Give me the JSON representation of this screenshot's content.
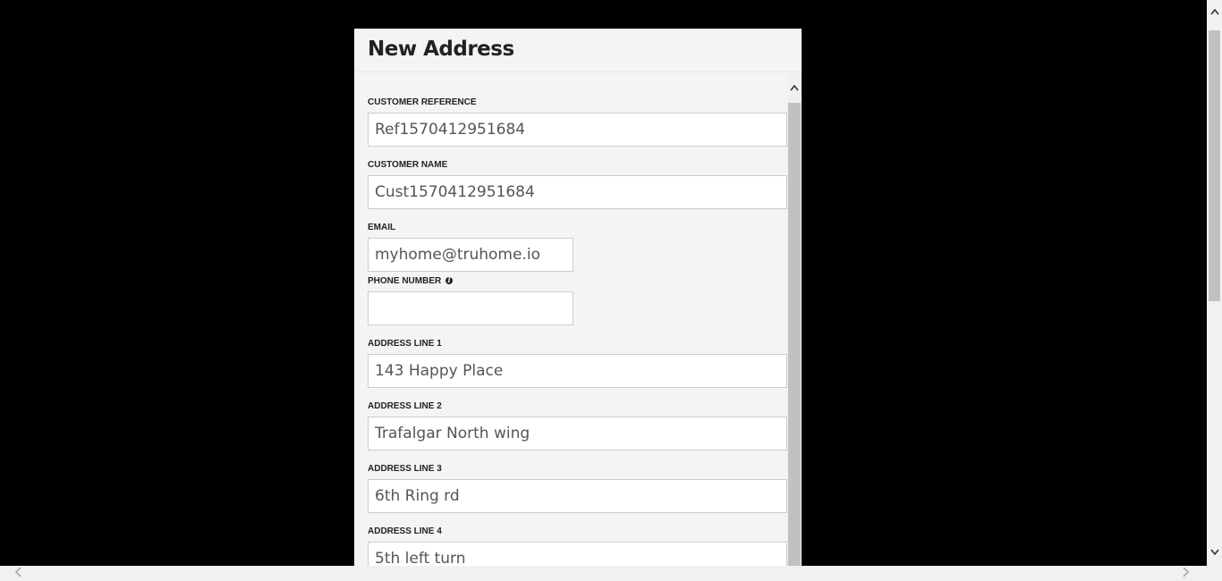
{
  "modal": {
    "title": "New Address"
  },
  "fields": {
    "customer_reference": {
      "label": "CUSTOMER REFERENCE",
      "value": "Ref1570412951684"
    },
    "customer_name": {
      "label": "CUSTOMER NAME",
      "value": "Cust1570412951684"
    },
    "email": {
      "label": "EMAIL",
      "value": "myhome@truhome.io"
    },
    "phone_number": {
      "label": "PHONE NUMBER",
      "value": "",
      "info_icon": "info-icon"
    },
    "address_line_1": {
      "label": "ADDRESS LINE 1",
      "value": "143 Happy Place"
    },
    "address_line_2": {
      "label": "ADDRESS LINE 2",
      "value": "Trafalgar North wing"
    },
    "address_line_3": {
      "label": "ADDRESS LINE 3",
      "value": "6th Ring rd"
    },
    "address_line_4": {
      "label": "ADDRESS LINE 4",
      "value": "5th left turn"
    }
  },
  "icons": {
    "scroll_up": "chevron-up-icon",
    "scroll_down": "chevron-down-icon",
    "scroll_left": "chevron-left-icon",
    "scroll_right": "chevron-right-icon"
  }
}
